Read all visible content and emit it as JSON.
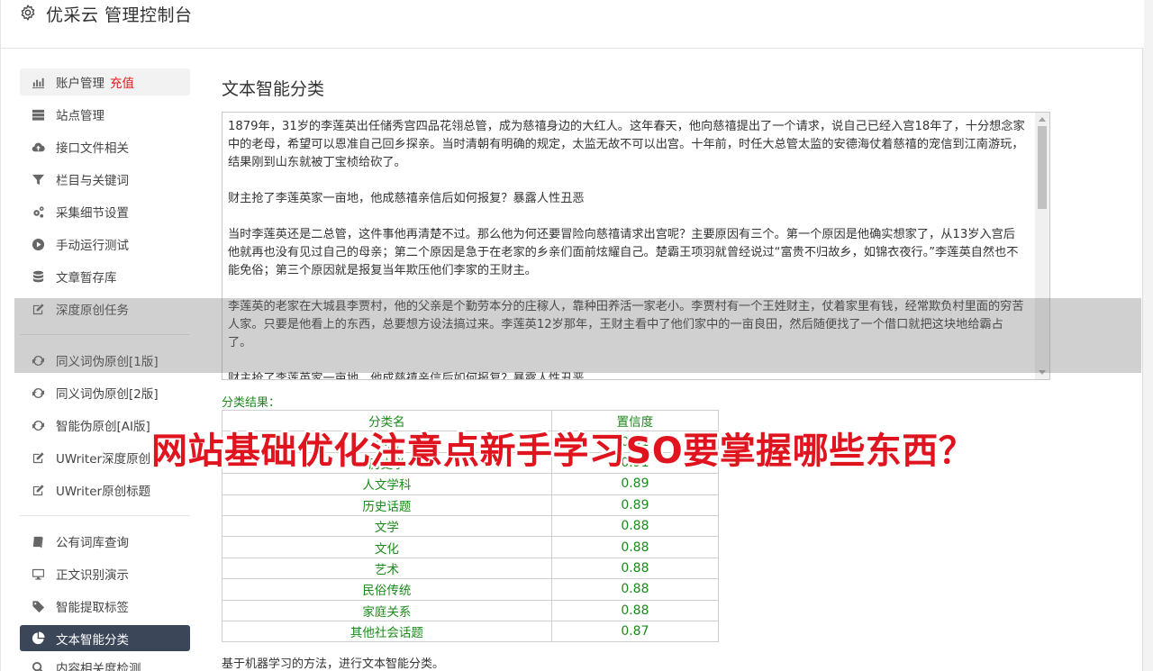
{
  "app": {
    "title": "优采云 管理控制台"
  },
  "sidebar": {
    "group1": [
      {
        "label": "账户管理",
        "badge": "充值",
        "icon": "bar-chart-icon"
      },
      {
        "label": "站点管理",
        "icon": "server-icon"
      },
      {
        "label": "接口文件相关",
        "icon": "cloud-upload-icon"
      },
      {
        "label": "栏目与关键词",
        "icon": "filter-icon"
      },
      {
        "label": "采集细节设置",
        "icon": "cogs-icon"
      },
      {
        "label": "手动运行测试",
        "icon": "play-circle-icon"
      },
      {
        "label": "文章暂存库",
        "icon": "database-icon"
      },
      {
        "label": "深度原创任务",
        "icon": "edit-icon"
      }
    ],
    "group2": [
      {
        "label": "同义词伪原创[1版]",
        "icon": "refresh-icon"
      },
      {
        "label": "同义词伪原创[2版]",
        "icon": "refresh-icon"
      },
      {
        "label": "智能伪原创[AI版]",
        "icon": "refresh-icon"
      },
      {
        "label": "UWriter深度原创",
        "icon": "edit-icon"
      },
      {
        "label": "UWriter原创标题",
        "icon": "edit-icon"
      }
    ],
    "group3": [
      {
        "label": "公有词库查询",
        "icon": "book-icon"
      },
      {
        "label": "正文识别演示",
        "icon": "monitor-icon"
      },
      {
        "label": "智能提取标签",
        "icon": "tag-icon"
      },
      {
        "label": "文本智能分类",
        "icon": "pie-chart-icon"
      },
      {
        "label": "内容相关度检测",
        "icon": "search-icon"
      }
    ]
  },
  "main": {
    "title": "文本智能分类",
    "text_paragraphs": [
      "1879年，31岁的李莲英出任储秀宫四品花翎总管，成为慈禧身边的大红人。这年春天，他向慈禧提出了一个请求，说自己已经入宫18年了，十分想念家中的老母，希望可以恩准自己回乡探亲。当时清朝有明确的规定，太监无故不可以出宫。十年前，时任大总管太监的安德海仗着慈禧的宠信到江南游玩，结果刚到山东就被丁宝桢给砍了。",
      "财主抢了李莲英家一亩地，他成慈禧亲信后如何报复？暴露人性丑恶",
      "当时李莲英还是二总管，这件事他再清楚不过。那么他为何还要冒险向慈禧请求出宫呢？主要原因有三个。第一个原因是他确实想家了，从13岁入宫后他就再也没有见过自己的母亲；第二个原因是急于在老家的乡亲们面前炫耀自己。楚霸王项羽就曾经说过“富贵不归故乡，如锦衣夜行。”李莲英自然也不能免俗；第三个原因就是报复当年欺压他们李家的王财主。",
      "李莲英的老家在大城县李贾村，他的父亲是个勤劳本分的庄稼人，靠种田养活一家老小。李贾村有一个王姓财主，仗着家里有钱，经常欺负村里面的穷苦人家。只要是他看上的东西，总要想方设法搞过来。李莲英12岁那年，王财主看中了他们家中的一亩良田，然后随便找了一个借口就把这块地给霸占了。",
      "财主抢了李莲英家一亩地，他成慈禧亲信后如何报复？暴露人性丑恶"
    ],
    "result_label": "分类结果：",
    "table": {
      "headers": [
        "分类名",
        "置信度"
      ],
      "rows": [
        {
          "category": "小说",
          "confidence": "0.91"
        },
        {
          "category": "历史学",
          "confidence": "0.91"
        },
        {
          "category": "人文学科",
          "confidence": "0.89"
        },
        {
          "category": "历史话题",
          "confidence": "0.89"
        },
        {
          "category": "文学",
          "confidence": "0.88"
        },
        {
          "category": "文化",
          "confidence": "0.88"
        },
        {
          "category": "艺术",
          "confidence": "0.88"
        },
        {
          "category": "民俗传统",
          "confidence": "0.88"
        },
        {
          "category": "家庭关系",
          "confidence": "0.88"
        },
        {
          "category": "其他社会话题",
          "confidence": "0.87"
        }
      ]
    },
    "footnote": "基于机器学习的方法，进行文本智能分类。"
  },
  "overlay": {
    "banner": "网站基础优化注意点新手学习SO要掌握哪些东西？"
  },
  "colors": {
    "active_bg": "#3b4658",
    "accent_green": "#1a8a1a",
    "recharge_red": "#e01b1b",
    "banner_red": "#e0141e"
  }
}
